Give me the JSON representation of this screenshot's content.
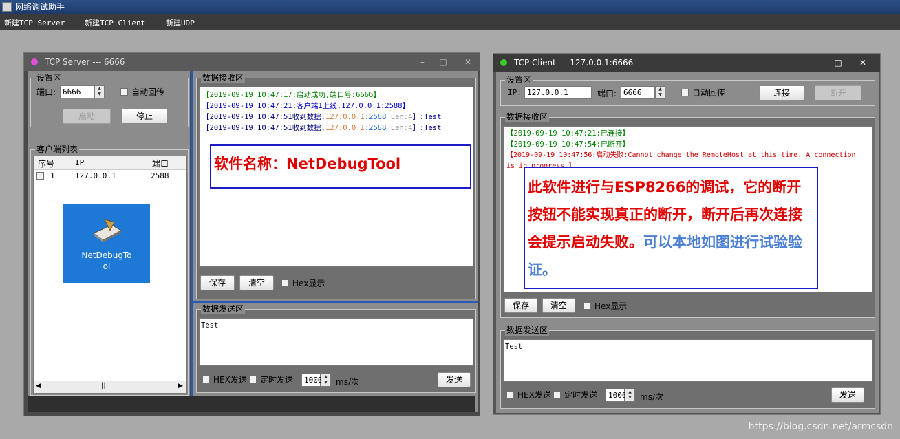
{
  "app": {
    "title": "网络调试助手",
    "menu": [
      "新建TCP Server",
      "新建TCP Client",
      "新建UDP"
    ]
  },
  "server": {
    "title": "TCP Server --- 6666",
    "settings": {
      "label": "设置区",
      "port_label": "端口:",
      "port_value": "6666",
      "auto_echo": "自动回传",
      "start": "启动",
      "stop": "停止"
    },
    "clients": {
      "label": "客户端列表",
      "headers": [
        "序号",
        "IP",
        "端口"
      ],
      "rows": [
        {
          "idx": "1",
          "ip": "127.0.0.1",
          "port": "2588"
        }
      ]
    },
    "desktop_icon_label": "NetDebugTool",
    "receive": {
      "label": "数据接收区",
      "lines": [
        {
          "text": "【2019-09-19 10:47:17:启动成功,端口号:6666】",
          "color": "#008000"
        },
        {
          "text": "【2019-09-19 10:47:21:客户端1上线,127.0.0.1:2588】",
          "color": "#0000cc"
        },
        {
          "parts": [
            {
              "t": "【2019-09-19 10:47:51收到数据,",
              "c": "#000080"
            },
            {
              "t": "127.0.0.1",
              "c": "#e07b39"
            },
            {
              "t": ":2588 ",
              "c": "#1e6fd9"
            },
            {
              "t": "Len:4",
              "c": "#9a9a9a"
            },
            {
              "t": "】:Test",
              "c": "#000080"
            }
          ]
        },
        {
          "parts": [
            {
              "t": "【2019-09-19 10:47:51收到数据,",
              "c": "#000080"
            },
            {
              "t": "127.0.0.1",
              "c": "#e07b39"
            },
            {
              "t": ":2588 ",
              "c": "#1e6fd9"
            },
            {
              "t": "Len:4",
              "c": "#9a9a9a"
            },
            {
              "t": "】:Test",
              "c": "#000080"
            }
          ]
        }
      ],
      "save": "保存",
      "clear": "清空",
      "hex_display": "Hex显示"
    },
    "annotation": "软件名称：NetDebugTool",
    "send": {
      "label": "数据发送区",
      "text": "Test",
      "hex_send": "HEX发送",
      "timed_send": "定时发送",
      "interval": "1000",
      "unit": "ms/次",
      "send": "发送"
    }
  },
  "client": {
    "title": "TCP Client --- 127.0.0.1:6666",
    "settings": {
      "label": "设置区",
      "ip_label": "IP:",
      "ip_value": "127.0.0.1",
      "port_label": "端口:",
      "port_value": "6666",
      "auto_echo": "自动回传",
      "connect": "连接",
      "disconnect": "断开"
    },
    "receive": {
      "label": "数据接收区",
      "lines": [
        {
          "text": "【2019-09-19 10:47:21:已连接】",
          "color": "#008000"
        },
        {
          "text": "【2019-09-19 10:47:54:已断开】",
          "color": "#008000"
        },
        {
          "text": "【2019-09-19 10:47:56:启动失败:Cannot change the RemoteHost at this time. A connection",
          "color": "#cc0000"
        },
        {
          "text": "is in progress.】",
          "color": "#cc0000"
        }
      ],
      "save": "保存",
      "clear": "清空",
      "hex_display": "Hex显示"
    },
    "annotation": {
      "red": "此软件进行与ESP8266的调试，它的断开按钮不能实现真正的断开，断开后再次连接会提示启动失败。",
      "blue": "可以本地如图进行试验验证。"
    },
    "send": {
      "label": "数据发送区",
      "text": "Test",
      "hex_send": "HEX发送",
      "timed_send": "定时发送",
      "interval": "1000",
      "unit": "ms/次",
      "send": "发送"
    }
  },
  "watermark": "https://blog.csdn.net/armcsdn",
  "colors": {
    "annotation_red": "#e00000",
    "annotation_blue": "#4a7fd4",
    "frame_blue": "#1a1ac8"
  }
}
